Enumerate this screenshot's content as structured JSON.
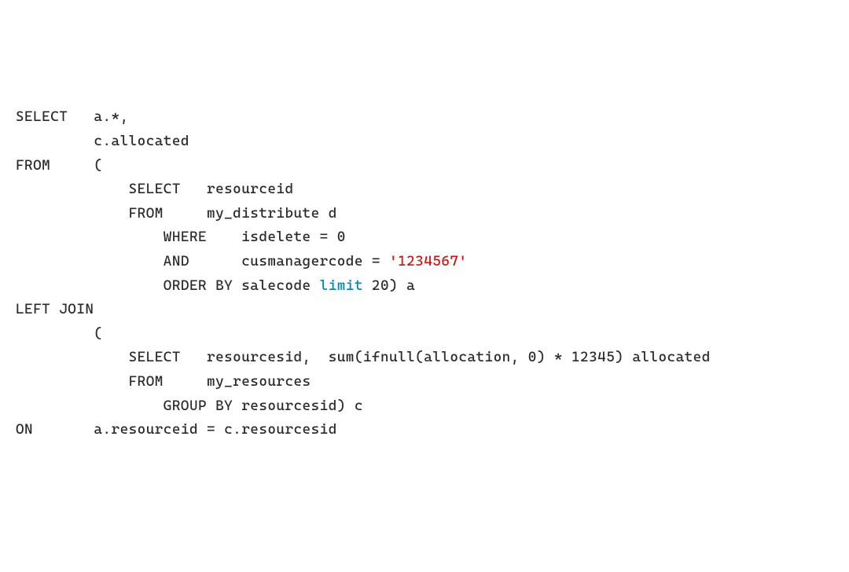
{
  "code": {
    "line1_kw": "SELECT",
    "line1_rest": "   a.*,",
    "line2": "         c.allocated",
    "line3_kw": "FROM",
    "line3_rest": "     (",
    "line4_kw": "             SELECT",
    "line4_rest": "   resourceid",
    "line5_kw": "             FROM",
    "line5_rest": "     my_distribute d",
    "line6_kw": "                 WHERE",
    "line6_rest": "    isdelete = 0",
    "line7_kw": "                 AND",
    "line7_rest": "      cusmanagercode = ",
    "line7_str": "'1234567'",
    "line8_kw": "                 ORDER BY",
    "line8_rest1": " salecode ",
    "line8_limit": "limit",
    "line8_rest2": " 20) a",
    "line9_kw": "LEFT JOIN",
    "line10": "         (",
    "line11_kw": "             SELECT",
    "line11_rest": "   resourcesid,  sum(ifnull(allocation, 0) * 12345) allocated",
    "line12_kw": "             FROM",
    "line12_rest": "     my_resources",
    "line13_kw": "                 GROUP BY",
    "line13_rest": " resourcesid) c",
    "line14_kw": "ON",
    "line14_rest": "       a.resourceid = c.resourcesid"
  }
}
